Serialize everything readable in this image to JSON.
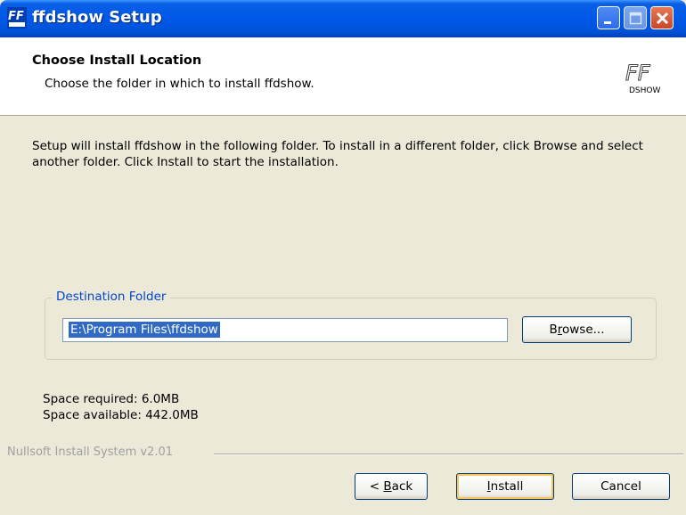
{
  "window": {
    "title": "ffdshow Setup",
    "icon": "ffdshow-app-icon",
    "controls": [
      "minimize-icon",
      "maximize-icon",
      "close-icon"
    ]
  },
  "header": {
    "title": "Choose Install Location",
    "subtitle": "Choose the folder in which to install ffdshow.",
    "logo_main": "FF",
    "logo_sub": "DSHOW"
  },
  "body": {
    "description": "Setup will install ffdshow in the following folder. To install in a different folder, click Browse and select another folder. Click Install to start the installation.",
    "destination_group_label": "Destination Folder",
    "destination_value": "E:\\Program Files\\ffdshow",
    "browse_label": "Browse...",
    "space_required": "Space required: 6.0MB",
    "space_available": "Space available: 442.0MB"
  },
  "footer": {
    "branding": "Nullsoft Install System v2.01",
    "back_label": "< Back",
    "install_label": "Install",
    "cancel_label": "Cancel"
  },
  "colors": {
    "titlebar": "#0058e8",
    "window_bg": "#ece9d8",
    "selection": "#316ac5",
    "group_label": "#0046d5"
  }
}
